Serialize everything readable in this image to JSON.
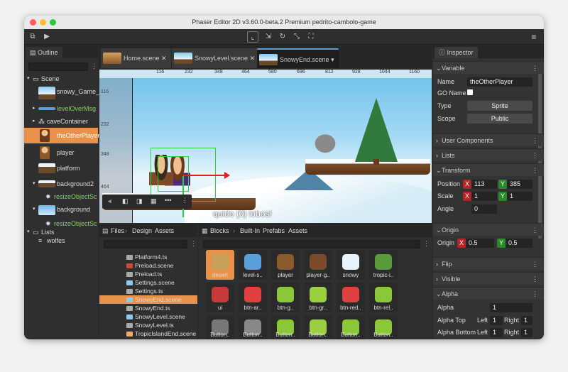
{
  "window": {
    "title": "Phaser Editor 2D v3.60.0-beta.2 Premium pedrito-cambolo-game"
  },
  "outline": {
    "tab": "Outline",
    "items": [
      {
        "label": "Scene",
        "icon": "folder-icon"
      },
      {
        "label": "snowy_Game_..."
      },
      {
        "label": "levelOverMsg"
      },
      {
        "label": "caveContainer"
      },
      {
        "label": "theOtherPlayer"
      },
      {
        "label": "player"
      },
      {
        "label": "platform"
      },
      {
        "label": "background2"
      },
      {
        "label": "resizeObjectSc"
      },
      {
        "label": "background"
      },
      {
        "label": "resizeObjectSc"
      },
      {
        "label": "Lists"
      },
      {
        "label": "wolfes"
      }
    ]
  },
  "editor": {
    "tabs": [
      "Home.scene",
      "SnowyLevel.scene",
      "SnowyEnd.scene"
    ],
    "ruler_top": [
      "116",
      "232",
      "348",
      "464",
      "580",
      "696",
      "812",
      "928",
      "1044",
      "1160"
    ],
    "ruler_left": [
      "116",
      "232",
      "348",
      "464"
    ],
    "game_text": "quido {0} lobos!"
  },
  "files": {
    "tabs": [
      "Files",
      "Design",
      "Assets"
    ],
    "items": [
      "Platform4.ts",
      "Preload.scene",
      "Preload.ts",
      "Settings.scene",
      "Settings.ts",
      "SnowyEnd.scene",
      "SnowyEnd.ts",
      "SnowyLevel.scene",
      "SnowyLevel.ts",
      "TropicIslandEnd.scene"
    ]
  },
  "blocks": {
    "tabs": [
      "Blocks",
      "Built-In",
      "Prefabs",
      "Assets"
    ],
    "items": [
      "desert",
      "level-s..",
      "player",
      "player-g..",
      "snowy",
      "tropic-i..",
      "ui",
      "btn-ar..",
      "btn-g..",
      "btn-gr..",
      "btn-red..",
      "btn-rel..",
      "Button..",
      "Button..",
      "Button..",
      "Button..",
      "Button..",
      "Button.."
    ]
  },
  "inspector": {
    "tab": "Inspector",
    "variable": {
      "header": "Variable",
      "name_label": "Name",
      "name_value": "theOtherPlayer",
      "go_name_label": "GO Name",
      "type_label": "Type",
      "type_value": "Sprite",
      "scope_label": "Scope",
      "scope_value": "Public"
    },
    "sections": [
      "User Components",
      "Lists"
    ],
    "transform": {
      "header": "Transform",
      "position_label": "Position",
      "pos_x": "113",
      "pos_y": "385",
      "scale_label": "Scale",
      "scale_x": "1",
      "scale_y": "1",
      "angle_label": "Angle",
      "angle": "0",
      "x": "X",
      "y": "Y"
    },
    "origin": {
      "header": "Origin",
      "label": "Origin",
      "x": "0.5",
      "y": "0.5"
    },
    "flip": "Flip",
    "visible": "Visible",
    "alpha": {
      "header": "Alpha",
      "alpha_label": "Alpha",
      "alpha_value": "1",
      "top_label": "Alpha Top",
      "bottom_label": "Alpha Bottom",
      "left": "Left",
      "right": "Right",
      "tl": "1",
      "tr": "1",
      "bl": "1",
      "br": "1"
    }
  }
}
